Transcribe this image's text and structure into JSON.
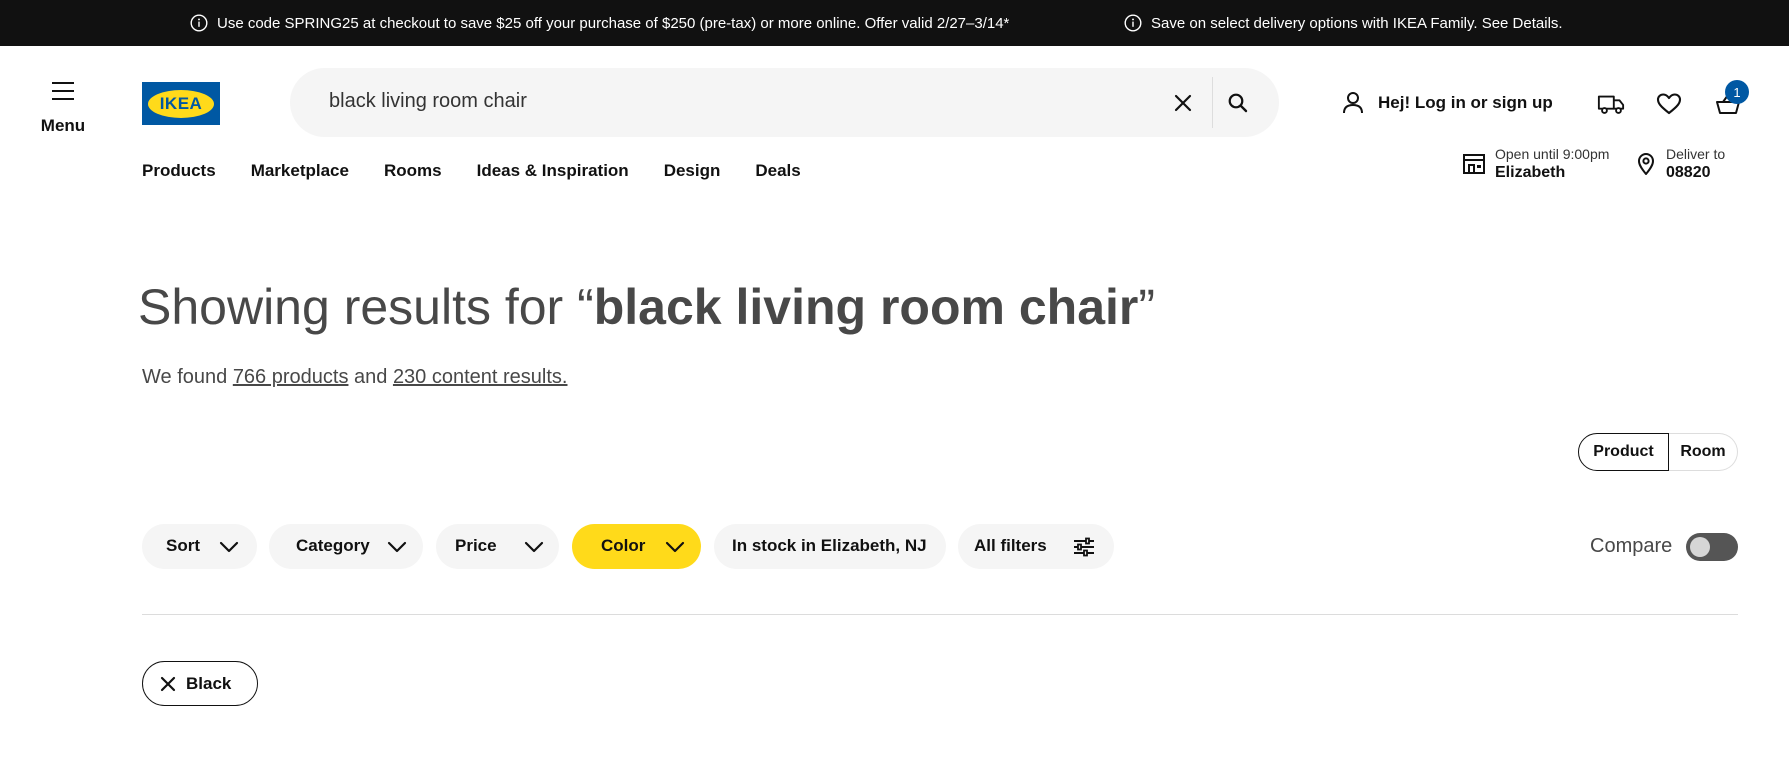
{
  "promo_bar": {
    "message_1": "Use code SPRING25 at checkout to save $25 off your purchase of $250 (pre-tax) or more online. Offer valid 2/27–3/14*",
    "message_2": "Save on select delivery options with IKEA Family. See Details."
  },
  "header": {
    "menu_label": "Menu",
    "logo_text": "IKEA",
    "search": {
      "value": "black living room chair"
    },
    "login_label": "Hej! Log in or sign up",
    "cart_count": "1"
  },
  "nav": {
    "items": [
      "Products",
      "Marketplace",
      "Rooms",
      "Ideas & Inspiration",
      "Design",
      "Deals"
    ]
  },
  "store": {
    "hours": "Open until 9:00pm",
    "name": "Elizabeth"
  },
  "delivery": {
    "label": "Deliver to",
    "zip": "08820"
  },
  "results": {
    "title_prefix": "Showing results for “",
    "query": "black living room chair",
    "title_suffix": "”",
    "sub_prefix": "We found ",
    "products_link": "766 products",
    "sub_middle": " and ",
    "content_link": "230 content results."
  },
  "view_toggle": {
    "product": "Product",
    "room": "Room",
    "selected": "Product"
  },
  "filters": {
    "sort": "Sort",
    "category": "Category",
    "price": "Price",
    "color": "Color",
    "stock": "In stock in Elizabeth, NJ",
    "all": "All filters"
  },
  "compare": {
    "label": "Compare",
    "enabled": false
  },
  "active_filters": [
    {
      "label": "Black"
    }
  ],
  "colors": {
    "promo_bg": "#111111",
    "brand_blue": "#0058a3",
    "brand_yellow": "#ffda1a",
    "pill_bg": "#f5f5f5"
  }
}
